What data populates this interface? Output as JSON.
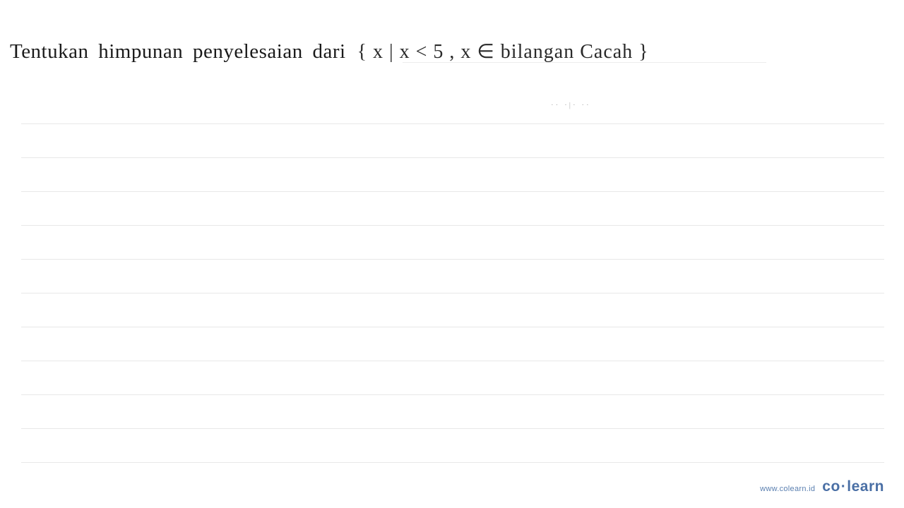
{
  "question": {
    "printed_text": "Tentukan  himpunan  penyelesaian  dari",
    "handwritten_text": "{ x |  x < 5 ,  x ∈ bilangan  Cacah }"
  },
  "marks": "·· ·|· ··",
  "footer": {
    "url": "www.colearn.id",
    "brand_part1": "co",
    "brand_dot": "·",
    "brand_part2": "learn"
  }
}
